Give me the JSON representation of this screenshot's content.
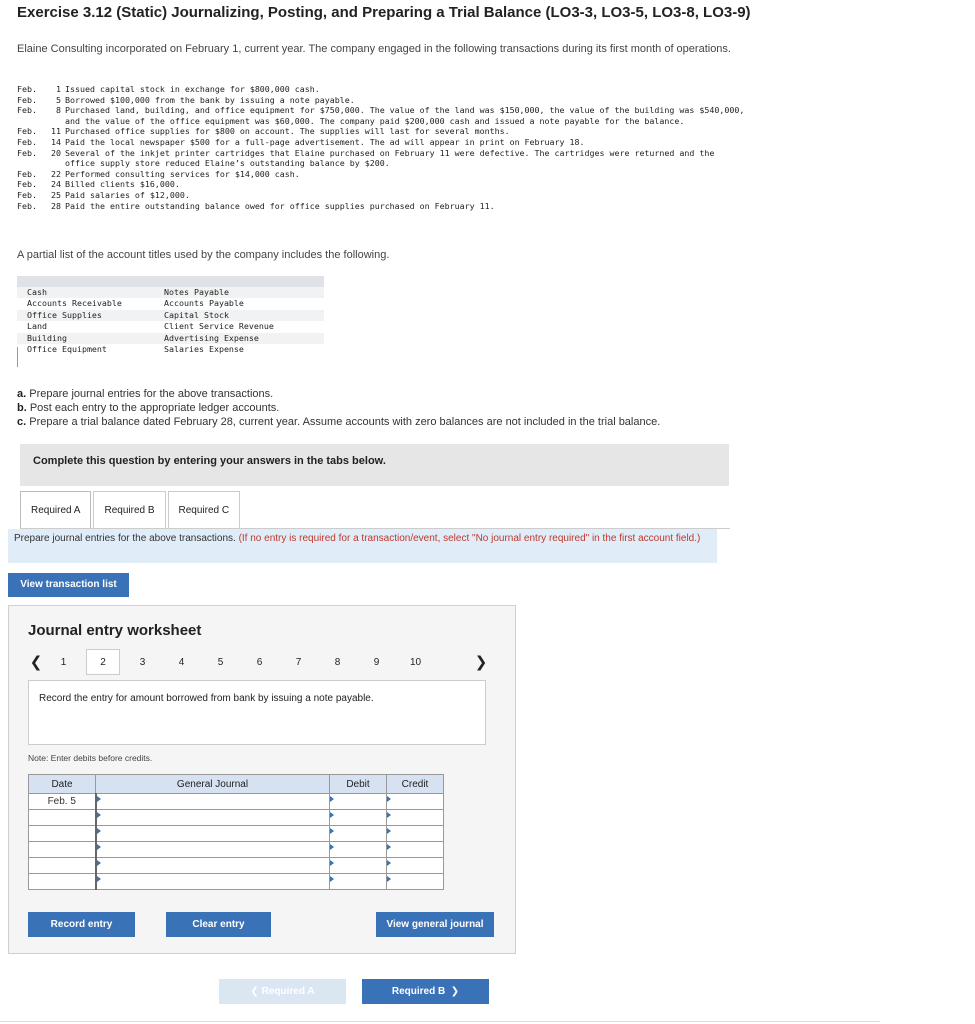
{
  "title": "Exercise 3.12 (Static) Journalizing, Posting, and Preparing a Trial Balance (LO3-3, LO3-5, LO3-8, LO3-9)",
  "intro": "Elaine Consulting incorporated on February 1, current year. The company engaged in the following transactions during its first month of operations.",
  "transactions": [
    {
      "month": "Feb.",
      "day": "1",
      "text": "Issued capital stock in exchange for $800,000 cash."
    },
    {
      "month": "Feb.",
      "day": "5",
      "text": "Borrowed $100,000 from the bank by issuing a note payable."
    },
    {
      "month": "Feb.",
      "day": "8",
      "text": "Purchased land, building, and office equipment for $750,000. The value of the land was $150,000, the value of the building was $540,000, and the value of the office equipment was $60,000. The company paid $200,000 cash and issued a note payable for the balance."
    },
    {
      "month": "Feb.",
      "day": "11",
      "text": "Purchased office supplies for $800 on account. The supplies will last for several months."
    },
    {
      "month": "Feb.",
      "day": "14",
      "text": "Paid the local newspaper $500 for a full-page advertisement. The ad will appear in print on February 18."
    },
    {
      "month": "Feb.",
      "day": "20",
      "text": "Several of the inkjet printer cartridges that Elaine purchased on February 11 were defective. The cartridges were returned and the office supply store reduced Elaine’s outstanding balance by $200."
    },
    {
      "month": "Feb.",
      "day": "22",
      "text": "Performed consulting services for $14,000 cash."
    },
    {
      "month": "Feb.",
      "day": "24",
      "text": "Billed clients $16,000."
    },
    {
      "month": "Feb.",
      "day": "25",
      "text": "Paid salaries of $12,000."
    },
    {
      "month": "Feb.",
      "day": "28",
      "text": "Paid the entire outstanding balance owed for office supplies purchased on February 11."
    }
  ],
  "partial_list": "A partial list of the account titles used by the company includes the following.",
  "accounts": [
    [
      "Cash",
      "Notes Payable"
    ],
    [
      "Accounts Receivable",
      "Accounts Payable"
    ],
    [
      "Office Supplies",
      "Capital Stock"
    ],
    [
      "Land",
      "Client Service Revenue"
    ],
    [
      "Building",
      "Advertising Expense"
    ],
    [
      "Office Equipment",
      "Salaries Expense"
    ]
  ],
  "tasks": [
    {
      "label": "a.",
      "text": "Prepare journal entries for the above transactions."
    },
    {
      "label": "b.",
      "text": "Post each entry to the appropriate ledger accounts."
    },
    {
      "label": "c.",
      "text": "Prepare a trial balance dated February 28, current year. Assume accounts with zero balances are not included in the trial balance."
    }
  ],
  "complete_text": "Complete this question by entering your answers in the tabs below.",
  "tabs": [
    "Required A",
    "Required B",
    "Required C"
  ],
  "instruction": "Prepare journal entries for the above transactions.",
  "instruction_note": "(If no entry is required for a transaction/event, select \"No journal entry required\" in the first account field.)",
  "view_transaction_list": "View transaction list",
  "worksheet": {
    "title": "Journal entry worksheet",
    "pages": [
      "1",
      "2",
      "3",
      "4",
      "5",
      "6",
      "7",
      "8",
      "9",
      "10"
    ],
    "current_page": "2",
    "prompt": "Record the entry for amount borrowed from bank by issuing a note payable.",
    "note": "Note: Enter debits before credits.",
    "columns": {
      "date": "Date",
      "general_journal": "General Journal",
      "debit": "Debit",
      "credit": "Credit"
    },
    "rows": [
      {
        "date": "Feb. 5"
      },
      {
        "date": ""
      },
      {
        "date": ""
      },
      {
        "date": ""
      },
      {
        "date": ""
      },
      {
        "date": ""
      }
    ],
    "record_entry": "Record entry",
    "clear_entry": "Clear entry",
    "view_general_journal": "View general journal"
  },
  "nav": {
    "prev": "Required A",
    "next": "Required B"
  },
  "colors": {
    "accent": "#3a72b8",
    "header_bg": "#d6e2f1",
    "instruction_bg": "#e0ecf8"
  }
}
